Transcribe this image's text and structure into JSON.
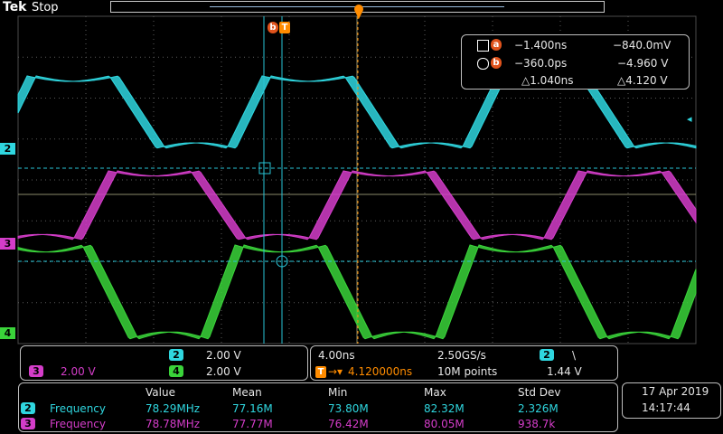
{
  "header": {
    "brand": "Tek",
    "state": "Stop"
  },
  "colors": {
    "ch2": "#2fd6df",
    "ch3": "#d43dc9",
    "ch4": "#3ad33a",
    "grid": "#5b5b5b",
    "cursor": "#29c4d6",
    "trigger": "#ff8c00",
    "cursor_badge": "#e0531c"
  },
  "channels": {
    "ch2": {
      "label": "2",
      "scale": "2.00 V"
    },
    "ch3": {
      "label": "3",
      "scale": "2.00 V"
    },
    "ch4": {
      "label": "4",
      "scale": "2.00 V"
    }
  },
  "cursor_markers": {
    "a": "a",
    "b": "b",
    "trigger": "T"
  },
  "cursor_readout": {
    "a": {
      "time": "−1.400ns",
      "volt": "−840.0mV"
    },
    "b": {
      "time": "−360.0ps",
      "volt": "−4.960 V"
    },
    "delta": {
      "time": "△1.040ns",
      "volt": "△4.120 V"
    }
  },
  "timebase": {
    "scale": "4.00ns",
    "sample_rate": "2.50GS/s",
    "trigger_pos": "4.120000ns",
    "record_length": "10M points",
    "trigger_channel": "2",
    "trigger_slope": "\\",
    "trigger_level": "1.44 V"
  },
  "measurements": {
    "headers": [
      "Value",
      "Mean",
      "Min",
      "Max",
      "Std Dev"
    ],
    "rows": [
      {
        "ch": "2",
        "name": "Frequency",
        "values": [
          "78.29MHz",
          "77.16M",
          "73.80M",
          "82.32M",
          "2.326M"
        ]
      },
      {
        "ch": "3",
        "name": "Frequency",
        "values": [
          "78.78MHz",
          "77.77M",
          "76.42M",
          "80.05M",
          "938.7k"
        ]
      }
    ]
  },
  "datetime": {
    "date": "17 Apr  2019",
    "time": "14:17:44"
  }
}
